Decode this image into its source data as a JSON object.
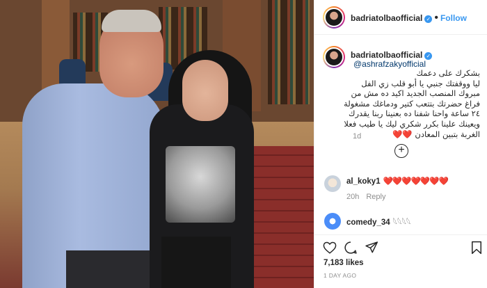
{
  "post": {
    "username": "badriatolbaofficial",
    "follow_label": "Follow",
    "separator": "•"
  },
  "caption": {
    "username": "badriatolbaofficial",
    "mention": "@ashrafzakyofficial",
    "text": "بشكرك على دعمك\nليا ووقفتك جنبي يا أبو قلب زي الفل\nمبروك المنصب الجديد اكيد ده مش من\nفراغ حضرتك بتتعب كتير ودماغك مشغولة\n٢٤ ساعة واحنا شفنا ده بعنينا ربنا يقدرك\nويعينك علينا بكرر شكري ليك يا طيب فعلا\nالغربة بتبين المعادن ❤️❤️",
    "time": "1d"
  },
  "comments": [
    {
      "username": "al_koky1",
      "text": "❤️❤️❤️❤️❤️❤️❤️",
      "time": "20h",
      "reply": "Reply"
    },
    {
      "username": "comedy_34",
      "text": "𓆩𓆩𓆩𓆩",
      "time": "",
      "reply": ""
    }
  ],
  "engagement": {
    "likes": "7,183 likes",
    "date": "1 DAY AGO"
  },
  "icons": {
    "like": "heart-icon",
    "comment": "comment-icon",
    "share": "share-icon",
    "save": "bookmark-icon",
    "add": "plus-circle-icon"
  },
  "colors": {
    "accent": "#3897f0",
    "text": "#262626",
    "muted": "#8e8e8e",
    "heart": "#ed4956"
  }
}
